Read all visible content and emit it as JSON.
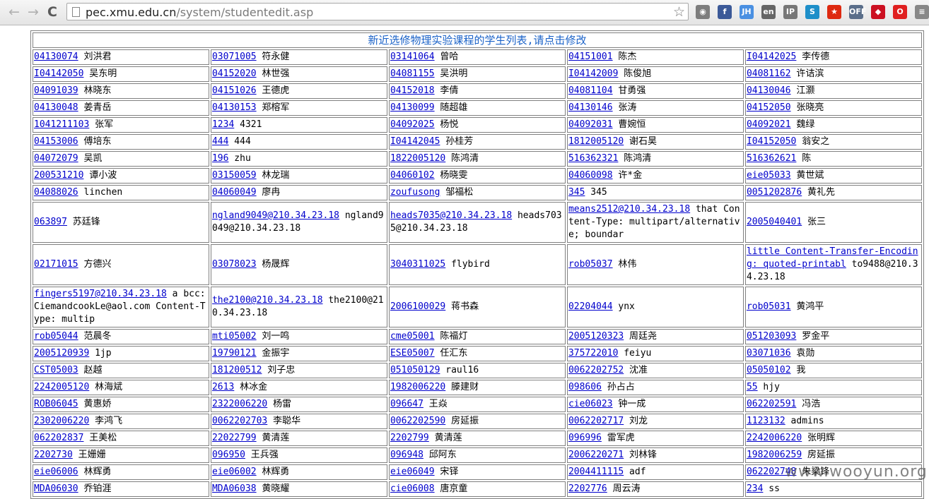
{
  "browser": {
    "url_host": "pec.xmu.edu.cn",
    "url_path": "/system/studentedit.asp",
    "back_glyph": "←",
    "forward_glyph": "→",
    "reload_glyph": "C",
    "star_glyph": "☆",
    "extensions": [
      {
        "name": "globe-extension-icon",
        "text": "◉",
        "color": "#7d7d7d"
      },
      {
        "name": "facebook-extension-icon",
        "text": "f",
        "color": "#3b5998"
      },
      {
        "name": "jh-extension-icon",
        "text": "JH",
        "color": "#4a90e2"
      },
      {
        "name": "en-extension-icon",
        "text": "en",
        "color": "#666666"
      },
      {
        "name": "ip-extension-icon",
        "text": "IP",
        "color": "#777777"
      },
      {
        "name": "s-extension-icon",
        "text": "S",
        "color": "#1e8fc9"
      },
      {
        "name": "china-flag-extension-icon",
        "text": "★",
        "color": "#de2910"
      },
      {
        "name": "off-extension-icon",
        "text": "OFF",
        "color": "#5a6e8a"
      },
      {
        "name": "diamond-extension-icon",
        "text": "◆",
        "color": "#cc1122"
      },
      {
        "name": "opera-extension-icon",
        "text": "O",
        "color": "#e02020"
      },
      {
        "name": "menu-icon",
        "text": "≡",
        "color": "#888888"
      }
    ]
  },
  "page": {
    "title": "新近选修物理实验课程的学生列表,请点击修改",
    "rows": [
      [
        {
          "id": "04130074",
          "name": "刘洪君"
        },
        {
          "id": "03071005",
          "name": "符永健"
        },
        {
          "id": "03141064",
          "name": "曾哈"
        },
        {
          "id": "04151001",
          "name": "陈杰"
        },
        {
          "id": "I04142025",
          "name": "李传德"
        }
      ],
      [
        {
          "id": "I04142050",
          "name": "吴东明"
        },
        {
          "id": "04152020",
          "name": "林世强"
        },
        {
          "id": "04081155",
          "name": "吴洪明"
        },
        {
          "id": "I04142009",
          "name": "陈俊旭"
        },
        {
          "id": "04081162",
          "name": "许诘滨"
        }
      ],
      [
        {
          "id": "04091039",
          "name": "林晓东"
        },
        {
          "id": "04151026",
          "name": "王德虎"
        },
        {
          "id": "04152018",
          "name": "李倩"
        },
        {
          "id": "04081104",
          "name": "甘勇强"
        },
        {
          "id": "04130046",
          "name": "江灏"
        }
      ],
      [
        {
          "id": "04130048",
          "name": "姜青岳"
        },
        {
          "id": "04130153",
          "name": "郑榕军"
        },
        {
          "id": "04130099",
          "name": "随超雄"
        },
        {
          "id": "04130146",
          "name": "张涛"
        },
        {
          "id": "04152050",
          "name": "张晓亮"
        }
      ],
      [
        {
          "id": "1041211103",
          "name": "张军"
        },
        {
          "id": "1234",
          "name": "4321"
        },
        {
          "id": "04092025",
          "name": "杨悦"
        },
        {
          "id": "04092031",
          "name": "曹婉恒"
        },
        {
          "id": "04092021",
          "name": "魏绿"
        }
      ],
      [
        {
          "id": "04153006",
          "name": "傅培东"
        },
        {
          "id": "444",
          "name": "444"
        },
        {
          "id": "I04142045",
          "name": "孙桂芳"
        },
        {
          "id": "1812005120",
          "name": "谢石昊"
        },
        {
          "id": "I04152050",
          "name": "翁安之"
        }
      ],
      [
        {
          "id": "04072079",
          "name": "吴凯"
        },
        {
          "id": "196",
          "name": "zhu"
        },
        {
          "id": "1822005120",
          "name": "陈鸿清"
        },
        {
          "id": "516362321",
          "name": "陈鸿清"
        },
        {
          "id": "516362621",
          "name": "陈"
        }
      ],
      [
        {
          "id": "200531210",
          "name": "谭小波"
        },
        {
          "id": "03150059",
          "name": "林龙瑞"
        },
        {
          "id": "04060102",
          "name": "杨晓雯"
        },
        {
          "id": "04060098",
          "name": "许*金"
        },
        {
          "id": "eie05033",
          "name": "黄世斌"
        }
      ],
      [
        {
          "id": "04088026",
          "name": "linchen"
        },
        {
          "id": "04060049",
          "name": "廖冉"
        },
        {
          "id": "zoufusong",
          "name": "邹福松"
        },
        {
          "id": "345",
          "name": "345"
        },
        {
          "id": "0051202876",
          "name": "黄礼先"
        }
      ],
      [
        {
          "id": "063897",
          "name": "苏廷锋"
        },
        {
          "id": "ngland9049@210.34.23.18",
          "name": "ngland9049@210.34.23.18"
        },
        {
          "id": "heads7035@210.34.23.18",
          "name": "heads7035@210.34.23.18"
        },
        {
          "id": "means2512@210.34.23.18",
          "name": "that Content-Type: multipart/alternative; boundar"
        },
        {
          "id": "2005040401",
          "name": "张三"
        }
      ],
      [
        {
          "id": "02171015",
          "name": "方德兴"
        },
        {
          "id": "03078023",
          "name": "杨晟辉"
        },
        {
          "id": "3040311025",
          "name": "flybird"
        },
        {
          "id": "rob05037",
          "name": "林伟"
        },
        {
          "id": "little Content-Transfer-Encoding: quoted-printabl",
          "name": "to9488@210.34.23.18"
        }
      ],
      [
        {
          "id": "fingers5197@210.34.23.18",
          "name": "a bcc: CiemandcookLe@aol.com Content-Type: multip"
        },
        {
          "id": "the2100@210.34.23.18",
          "name": "the2100@210.34.23.18"
        },
        {
          "id": "2006100029",
          "name": "蒋书森"
        },
        {
          "id": "02204044",
          "name": "ynx"
        },
        {
          "id": "rob05031",
          "name": "黄鸿平"
        }
      ],
      [
        {
          "id": "rob05044",
          "name": "范晨冬"
        },
        {
          "id": "mti05002",
          "name": "刘一鸣"
        },
        {
          "id": "cme05001",
          "name": "陈福灯"
        },
        {
          "id": "2005120323",
          "name": "周廷尧"
        },
        {
          "id": "051203093",
          "name": "罗金平"
        }
      ],
      [
        {
          "id": "2005120939",
          "name": "1jp"
        },
        {
          "id": "19790121",
          "name": "金振宇"
        },
        {
          "id": "ESE05007",
          "name": "任汇东"
        },
        {
          "id": "375722010",
          "name": "feiyu"
        },
        {
          "id": "03071036",
          "name": "袁勋"
        }
      ],
      [
        {
          "id": "CST05003",
          "name": "赵越"
        },
        {
          "id": "181200512",
          "name": "刘子忠"
        },
        {
          "id": "051050129",
          "name": "raul16"
        },
        {
          "id": "0062202752",
          "name": "沈准"
        },
        {
          "id": "05050102",
          "name": "我"
        }
      ],
      [
        {
          "id": "2242005120",
          "name": "林海斌"
        },
        {
          "id": "2613",
          "name": "林冰金"
        },
        {
          "id": "1982006220",
          "name": "滕建财"
        },
        {
          "id": "098606",
          "name": "孙占占"
        },
        {
          "id": "55",
          "name": "hjy"
        }
      ],
      [
        {
          "id": "ROB06045",
          "name": "黄惠娇"
        },
        {
          "id": "2322006220",
          "name": "杨雷"
        },
        {
          "id": "096647",
          "name": "王焱"
        },
        {
          "id": "cie06023",
          "name": "钟一成"
        },
        {
          "id": "062202591",
          "name": "冯浩"
        }
      ],
      [
        {
          "id": "2302006220",
          "name": "李鸿飞"
        },
        {
          "id": "0062202703",
          "name": "李聪华"
        },
        {
          "id": "0062202590",
          "name": "房延振"
        },
        {
          "id": "0062202717",
          "name": "刘龙"
        },
        {
          "id": "1123132",
          "name": "admins"
        }
      ],
      [
        {
          "id": "062202837",
          "name": "王美松"
        },
        {
          "id": "22022799",
          "name": "黄清莲"
        },
        {
          "id": "2202799",
          "name": "黄清莲"
        },
        {
          "id": "096996",
          "name": "雷军虎"
        },
        {
          "id": "2242006220",
          "name": "张明辉"
        }
      ],
      [
        {
          "id": "2202730",
          "name": "王姗姗"
        },
        {
          "id": "096950",
          "name": "王兵强"
        },
        {
          "id": "096948",
          "name": "邱阿东"
        },
        {
          "id": "2006220271",
          "name": "刘林锋"
        },
        {
          "id": "1982006259",
          "name": "房延振"
        }
      ],
      [
        {
          "id": "eie06006",
          "name": "林辉勇"
        },
        {
          "id": "eie06002",
          "name": "林辉勇"
        },
        {
          "id": "eie06049",
          "name": "宋铎"
        },
        {
          "id": "2004411115",
          "name": "adf"
        },
        {
          "id": "062202748",
          "name": "朱梁锋"
        }
      ],
      [
        {
          "id": "MDA06030",
          "name": "乔铂涯"
        },
        {
          "id": "MDA06038",
          "name": "黄晓耀"
        },
        {
          "id": "cie06008",
          "name": "唐京童"
        },
        {
          "id": "2202776",
          "name": "周云涛"
        },
        {
          "id": "234",
          "name": "ss"
        }
      ]
    ]
  },
  "watermark": "www.wooyun.org"
}
